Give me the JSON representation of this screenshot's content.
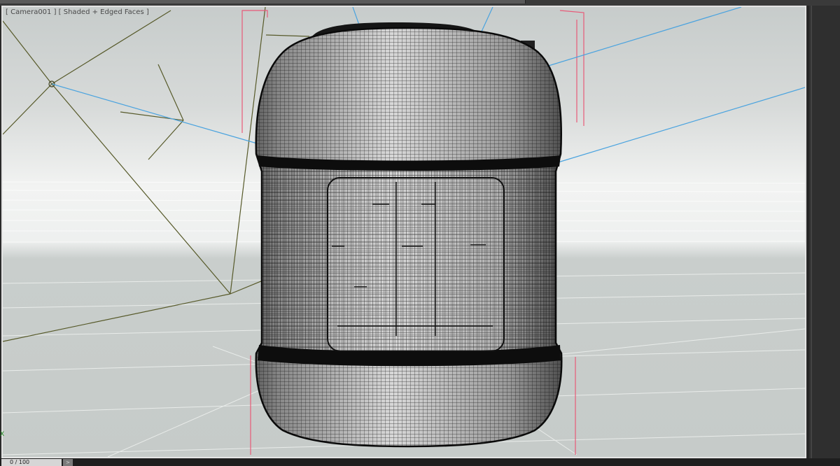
{
  "viewport": {
    "label": "[ Camera001 ] [ Shaded + Edged Faces ]",
    "display_mode": "Shaded + Edged Faces",
    "camera_name": "Camera001"
  },
  "timeline": {
    "frame_counter": "0 / 100",
    "next_icon": ">"
  },
  "axis": {
    "label": "X"
  },
  "colors": {
    "viewport_bg": "#cfd3d1",
    "wire": "#111111",
    "camera_target": "#4aa3df",
    "bounding_box": "#e85a78",
    "camera_frustum": "#575a2a"
  },
  "icons": {
    "frame_next": "chevron-right-icon"
  }
}
